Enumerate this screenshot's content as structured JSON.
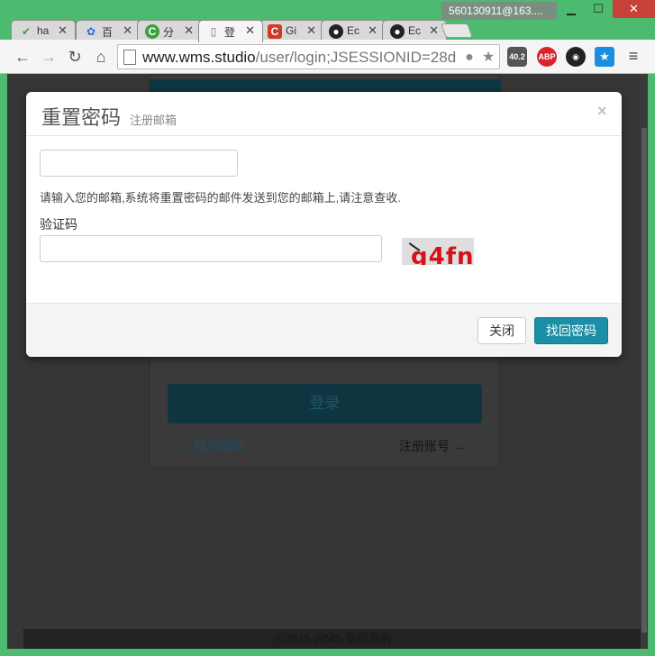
{
  "window": {
    "profile": "560130911@163....",
    "minimize": "▁",
    "maximize": "☐",
    "close": "✕"
  },
  "tabs": [
    {
      "icon": "hao",
      "title": "ha",
      "color": "#3aa23a"
    },
    {
      "icon": "百",
      "title": "百",
      "color": "#2b6de0"
    },
    {
      "icon": "C",
      "title": "分",
      "color": "#3aa23a"
    },
    {
      "icon": "doc",
      "title": "登",
      "color": "#777777",
      "active": true
    },
    {
      "icon": "C",
      "title": "Gi",
      "color": "#d03a2a"
    },
    {
      "icon": "gh",
      "title": "Ec",
      "color": "#222222"
    },
    {
      "icon": "gh",
      "title": "Ec",
      "color": "#222222"
    }
  ],
  "toolbar": {
    "back": "←",
    "forward": "→",
    "reload": "↻",
    "home": "⌂",
    "url_host": "www.wms.studio",
    "url_path": "/user/login;JSESSIONID=28d",
    "ext_timer": "40.2",
    "ext_abp": "ABP",
    "menu": "≡"
  },
  "background": {
    "login_button": "登录",
    "forgot_link": "← 找回密码",
    "register_link": "注册账号 →",
    "footer": "©2015 WMS 版权所有"
  },
  "modal": {
    "title": "重置密码",
    "subtitle": "注册邮箱",
    "close": "×",
    "email_placeholder": "",
    "help_text": "请输入您的邮箱,系统将重置密码的邮件发送到您的邮箱上,请注意查收.",
    "captcha_label": "验证码",
    "captcha_placeholder": "",
    "captcha_text": "g4fn",
    "btn_close": "关闭",
    "btn_submit": "找回密码"
  },
  "colors": {
    "accent": "#1a8fa6",
    "window_frame": "#4dbb6f",
    "close_button": "#c7413a"
  }
}
